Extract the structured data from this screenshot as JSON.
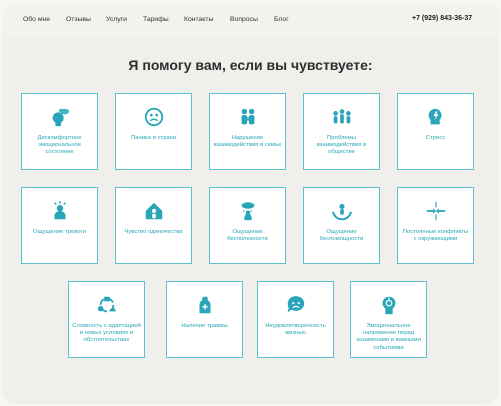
{
  "nav": {
    "items": [
      "Обо мне",
      "Отзывы",
      "Услуги",
      "Тарифы",
      "Контакты",
      "Вопросы",
      "Блог"
    ],
    "phone": "+7 (929) 843-36-37"
  },
  "headline": "Я помогу вам, если вы чувствуете:",
  "accent_color": "#29a5b8",
  "cards": [
    {
      "label": "Дискомфортное эмоциональное состояние",
      "icon": "head-cloud-icon"
    },
    {
      "label": "Паника и страхи",
      "icon": "anxious-face-icon"
    },
    {
      "label": "Нарушение взаимодействия в семье",
      "icon": "family-icon"
    },
    {
      "label": "Проблемы взаимодействия в обществе",
      "icon": "group-icon"
    },
    {
      "label": "Стресс",
      "icon": "head-lightning-icon"
    },
    {
      "label": "Ощущение тревоги",
      "icon": "alarmed-person-icon"
    },
    {
      "label": "Чувство одиночества",
      "icon": "lonely-house-icon"
    },
    {
      "label": "Ощущение бесполезности",
      "icon": "rain-cloud-person-icon"
    },
    {
      "label": "Ощущение беспомощности",
      "icon": "hands-holding-person-icon"
    },
    {
      "label": "Постоянные конфликты с окружающими",
      "icon": "conflict-arrows-icon"
    },
    {
      "label": "Сложность с адаптацией в новых условиях и обстоятельствах",
      "icon": "adaptation-cycle-icon"
    },
    {
      "label": "Наличие травмы",
      "icon": "trauma-hand-icon"
    },
    {
      "label": "Неудовлетворенность жизнью",
      "icon": "sad-bubble-icon"
    },
    {
      "label": "Эмоциональное напряжение перед экзаменами и важными событиями",
      "icon": "tense-head-icon"
    }
  ]
}
